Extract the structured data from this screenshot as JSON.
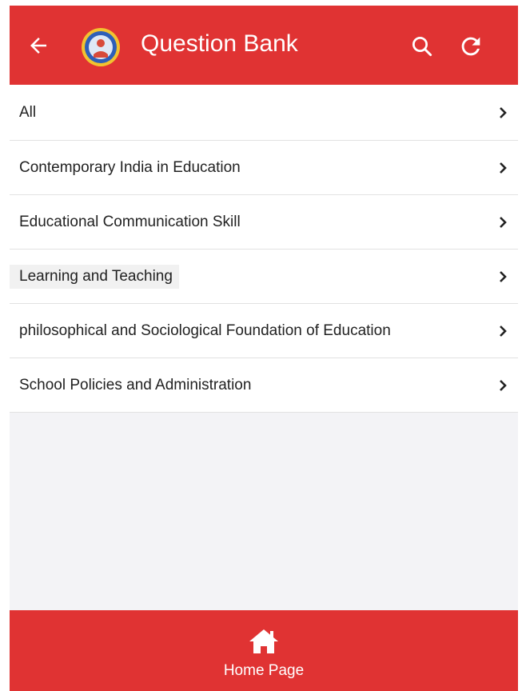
{
  "header": {
    "title": "Question Bank",
    "back_icon": "arrow-left-icon",
    "logo_icon": "school-emblem-logo",
    "search_icon": "search-icon",
    "refresh_icon": "refresh-icon",
    "background_color": "#e03333"
  },
  "subjects": [
    {
      "label": "All"
    },
    {
      "label": "Contemporary India in Education"
    },
    {
      "label": "Educational Communication Skill"
    },
    {
      "label": "Learning and Teaching"
    },
    {
      "label": "philosophical and Sociological Foundation of Education"
    },
    {
      "label": "School Policies and Administration"
    }
  ],
  "footer": {
    "home_label": "Home Page",
    "home_icon": "home-icon"
  }
}
